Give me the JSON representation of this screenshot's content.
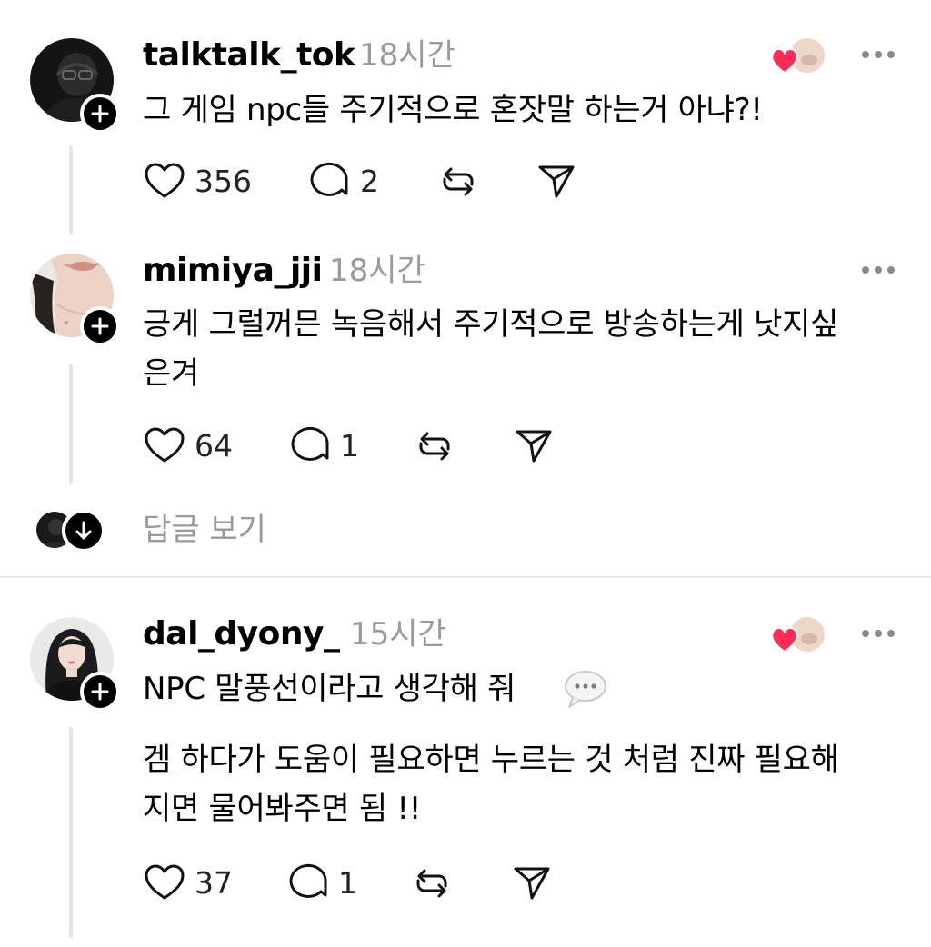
{
  "comments": [
    {
      "username": "talktalk_tok",
      "time": "18시간",
      "text_lines": [
        "그 게임 npc들 주기적으로 혼잣말 하는거 아냐?!"
      ],
      "likes": "356",
      "replies": "2",
      "author_liked": true
    },
    {
      "username": "mimiya_jji",
      "time": "18시간",
      "text_lines": [
        "긍게 그럴꺼믄 녹음해서 주기적으로 방송하는게 낫지싶",
        "은겨"
      ],
      "likes": "64",
      "replies": "1",
      "author_liked": false
    },
    {
      "username": "dal_dyony_",
      "time": "15시간",
      "text_lines": [
        "NPC 말풍선이라고 생각해 줘",
        "겜 하다가 도움이 필요하면 누르는 것 처럼 진짜 필요해",
        "지면 물어봐주면 됨 !!"
      ],
      "likes": "37",
      "replies": "1",
      "author_liked": true
    }
  ],
  "view_replies_label": "답글 보기",
  "icons": [
    "heart-icon",
    "comment-icon",
    "repost-icon",
    "share-icon",
    "more-icon",
    "plus-icon",
    "arrow-down-icon"
  ],
  "colors": {
    "liked_heart": "#ff2d55",
    "secondary_text": "#9a9a9a",
    "divider": "#e7e7e7"
  }
}
